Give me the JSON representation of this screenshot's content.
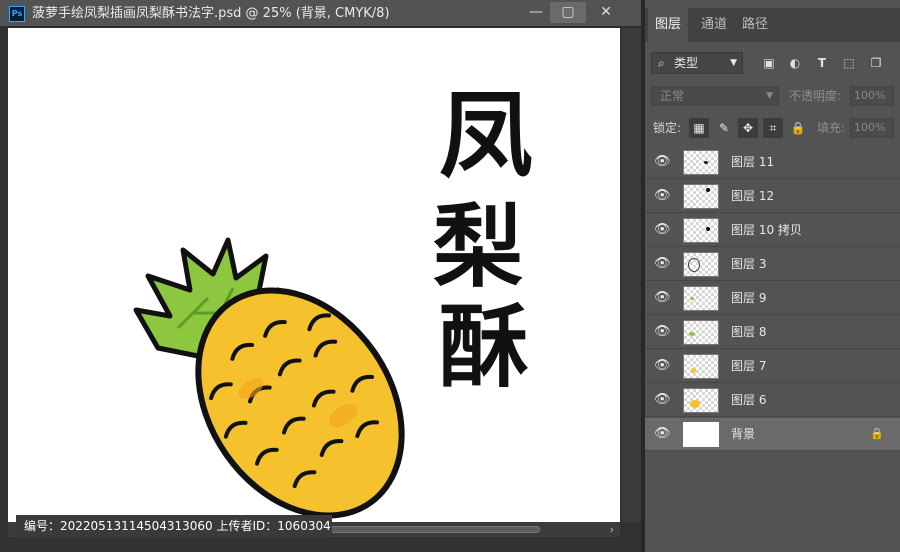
{
  "document": {
    "title": "菠萝手绘凤梨插画凤梨酥书法字.psd @ 25% (背景, CMYK/8)",
    "app_icon": "Ps",
    "window_controls": {
      "minimize": "—",
      "maximize": "▢",
      "close": "✕"
    }
  },
  "canvas": {
    "calligraphy": [
      "凤",
      "梨",
      "酥"
    ],
    "watermark_text": "编号：20220513114504313060 上传者ID：1060304"
  },
  "layers_panel": {
    "tabs": [
      {
        "label": "图层",
        "active": true
      },
      {
        "label": "通道",
        "active": false
      },
      {
        "label": "路径",
        "active": false
      }
    ],
    "filter": {
      "kind_label": "类型",
      "icons": [
        "image-filter-icon",
        "adjustment-filter-icon",
        "type-filter-icon",
        "shape-filter-icon",
        "smart-object-filter-icon"
      ]
    },
    "blend_mode": "正常",
    "opacity_label": "不透明度:",
    "opacity_value": "100%",
    "lock_label": "锁定:",
    "fill_label": "填充:",
    "fill_value": "100%",
    "layers": [
      {
        "name": "图层 11",
        "visible": true,
        "selected": false,
        "locked": false
      },
      {
        "name": "图层 12",
        "visible": true,
        "selected": false,
        "locked": false
      },
      {
        "name": "图层 10 拷贝",
        "visible": true,
        "selected": false,
        "locked": false
      },
      {
        "name": "图层 3",
        "visible": true,
        "selected": false,
        "locked": false
      },
      {
        "name": "图层 9",
        "visible": true,
        "selected": false,
        "locked": false
      },
      {
        "name": "图层 8",
        "visible": true,
        "selected": false,
        "locked": false
      },
      {
        "name": "图层 7",
        "visible": true,
        "selected": false,
        "locked": false
      },
      {
        "name": "图层 6",
        "visible": true,
        "selected": false,
        "locked": false
      },
      {
        "name": "背景",
        "visible": true,
        "selected": true,
        "locked": true
      }
    ]
  },
  "colors": {
    "pineapple_body": "#f5c22e",
    "pineapple_leaves": "#8dc63f",
    "ink": "#111111",
    "selected_layer": "#6a6a6a"
  }
}
